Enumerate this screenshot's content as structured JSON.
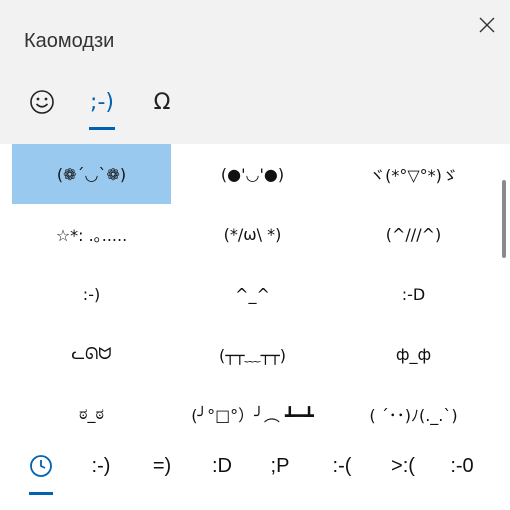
{
  "panel": {
    "title": "Каомодзи",
    "close_icon": "close-icon"
  },
  "tabs": [
    {
      "name": "emoji",
      "icon": "smiley-face-icon",
      "label": "☺",
      "active": false
    },
    {
      "name": "kaomoji",
      "label": ";-)",
      "active": true
    },
    {
      "name": "symbols",
      "icon": "omega-icon",
      "label": "Ω",
      "active": false
    }
  ],
  "kaomoji": [
    "(❁´◡`❁)",
    "(●'◡'●)",
    "ヾ(*°▽°*)ゞ",
    "☆*: .｡.....",
    "(*/ω\\ *)",
    "(^///^)",
    ":-)",
    "^_^",
    ":-D",
    "ᓚᘏᗢ",
    "(┬┬﹏┬┬)",
    "ф_ф",
    "ಠ_ಠ",
    "(╯°□°）╯︵ ┻━┻",
    "( ´･･)ﾉ(._.`)"
  ],
  "selected_index": 0,
  "recent_bar": {
    "clock_icon": "clock-icon",
    "items": [
      ":-)",
      "=)",
      ":D",
      ";P",
      ":-(",
      ">:(",
      ":-0"
    ]
  },
  "colors": {
    "accent": "#0063b1",
    "selection": "#99c9ef",
    "header_bg": "#f2f2f2"
  }
}
